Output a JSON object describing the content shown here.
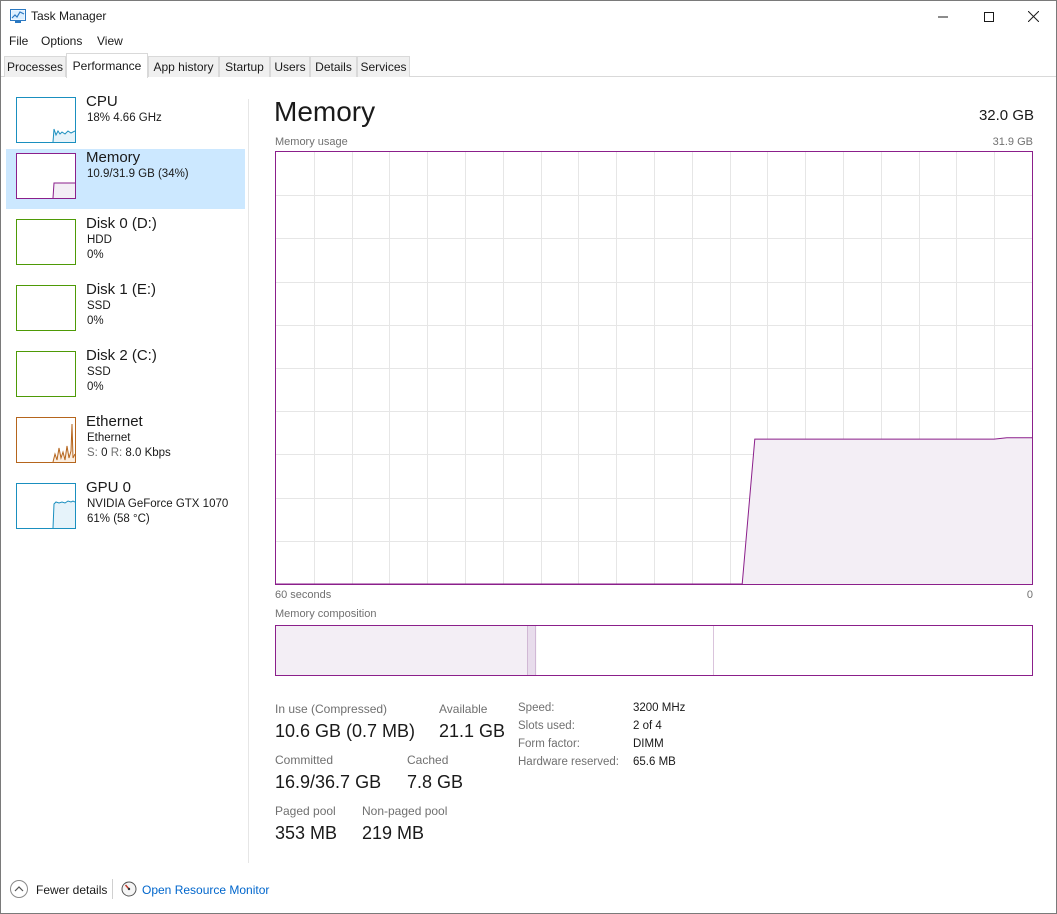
{
  "window": {
    "title": "Task Manager",
    "icons": {
      "app": "task-manager-icon",
      "minimize": "minimize-icon",
      "maximize": "maximize-icon",
      "close": "close-icon"
    }
  },
  "menu": [
    "File",
    "Options",
    "View"
  ],
  "tabs": [
    {
      "label": "Processes",
      "active": false
    },
    {
      "label": "Performance",
      "active": true
    },
    {
      "label": "App history",
      "active": false
    },
    {
      "label": "Startup",
      "active": false
    },
    {
      "label": "Users",
      "active": false
    },
    {
      "label": "Details",
      "active": false
    },
    {
      "label": "Services",
      "active": false
    }
  ],
  "sidebar": {
    "items": [
      {
        "name": "CPU",
        "line1": "18% 4.66 GHz",
        "line2": "",
        "selected": false,
        "color": "#1a8fbf"
      },
      {
        "name": "Memory",
        "line1": "10.9/31.9 GB (34%)",
        "line2": "",
        "selected": true,
        "color": "#8b1f8b"
      },
      {
        "name": "Disk 0 (D:)",
        "line1": "HDD",
        "line2": "0%",
        "selected": false,
        "color": "#4e9a06"
      },
      {
        "name": "Disk 1 (E:)",
        "line1": "SSD",
        "line2": "0%",
        "selected": false,
        "color": "#4e9a06"
      },
      {
        "name": "Disk 2 (C:)",
        "line1": "SSD",
        "line2": "0%",
        "selected": false,
        "color": "#4e9a06"
      },
      {
        "name": "Ethernet",
        "line1": "Ethernet",
        "line2_label_s": "S:",
        "line2_value_s": "0",
        "line2_label_r": "R:",
        "line2_value_r": "8.0 Kbps",
        "selected": false,
        "color": "#b5651d"
      },
      {
        "name": "GPU 0",
        "line1": "NVIDIA GeForce GTX 1070",
        "line2": "61% (58 °C)",
        "selected": false,
        "color": "#1a8fbf"
      }
    ]
  },
  "main": {
    "title": "Memory",
    "total": "32.0 GB",
    "usage_label": "Memory usage",
    "usage_max": "31.9 GB",
    "axis_left": "60 seconds",
    "axis_right": "0",
    "composition_label": "Memory composition",
    "accent": "#8b1f8b",
    "stats": {
      "in_use_label": "In use (Compressed)",
      "in_use_value": "10.6 GB (0.7 MB)",
      "available_label": "Available",
      "available_value": "21.1 GB",
      "committed_label": "Committed",
      "committed_value": "16.9/36.7 GB",
      "cached_label": "Cached",
      "cached_value": "7.8 GB",
      "paged_label": "Paged pool",
      "paged_value": "353 MB",
      "nonpaged_label": "Non-paged pool",
      "nonpaged_value": "219 MB"
    },
    "details": [
      {
        "label": "Speed:",
        "value": "3200 MHz"
      },
      {
        "label": "Slots used:",
        "value": "2 of 4"
      },
      {
        "label": "Form factor:",
        "value": "DIMM"
      },
      {
        "label": "Hardware reserved:",
        "value": "65.6 MB"
      }
    ]
  },
  "chart_data": {
    "type": "area",
    "x_range_seconds": [
      60,
      0
    ],
    "ylim_gb": [
      0,
      31.9
    ],
    "series": [
      {
        "values_gb": [
          0,
          0,
          0,
          0,
          0,
          0,
          0,
          0,
          0,
          0,
          0,
          0,
          0,
          0,
          0,
          0,
          0,
          0,
          0,
          0,
          0,
          0,
          0,
          0,
          0,
          0,
          0,
          0,
          0,
          0,
          0,
          0,
          0,
          0,
          0,
          0,
          0,
          0,
          10.7,
          10.7,
          10.7,
          10.7,
          10.7,
          10.7,
          10.7,
          10.7,
          10.7,
          10.7,
          10.7,
          10.7,
          10.7,
          10.7,
          10.7,
          10.7,
          10.7,
          10.7,
          10.7,
          10.7,
          10.8,
          10.8,
          10.8
        ]
      }
    ],
    "composition": [
      {
        "part": "In use",
        "fraction": 0.333
      },
      {
        "part": "Modified",
        "fraction": 0.011
      },
      {
        "part": "Standby",
        "fraction": 0.235
      },
      {
        "part": "Free",
        "fraction": 0.421
      }
    ]
  },
  "footer": {
    "fewer_details": "Fewer details",
    "resource_monitor": "Open Resource Monitor",
    "icons": {
      "fewer": "chevron-up-icon",
      "monitor": "resource-monitor-icon"
    }
  }
}
